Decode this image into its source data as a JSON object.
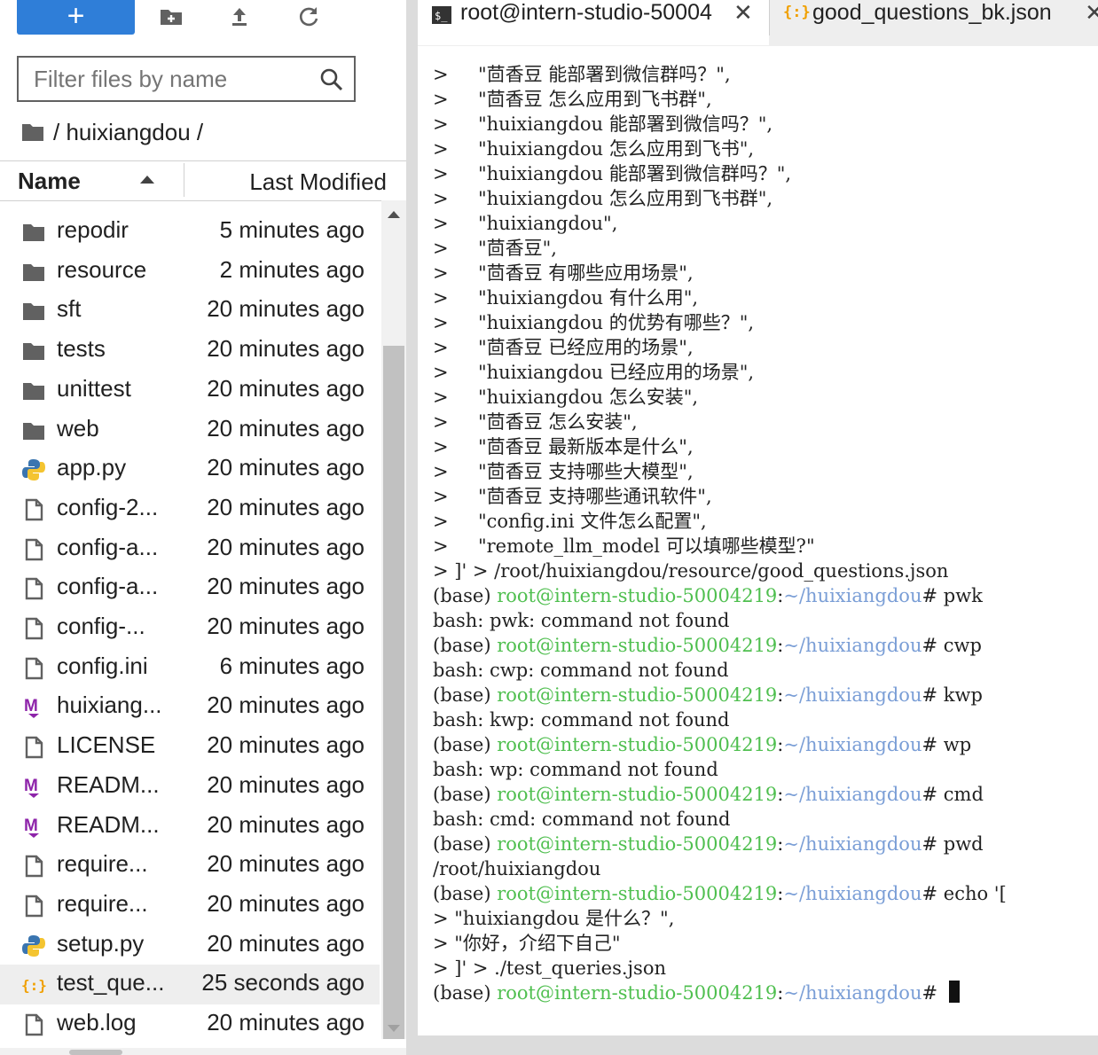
{
  "toolbar": {
    "new_label": "+",
    "icons": [
      "new-folder-icon",
      "upload-icon",
      "refresh-icon"
    ]
  },
  "filter": {
    "placeholder": "Filter files by name"
  },
  "breadcrumb": {
    "path": "/ huixiangdou /"
  },
  "columns": {
    "name": "Name",
    "modified": "Last Modified"
  },
  "files": [
    {
      "name": "repodir",
      "modified": "5 minutes ago",
      "icon": "folder-icon"
    },
    {
      "name": "resource",
      "modified": "2 minutes ago",
      "icon": "folder-icon"
    },
    {
      "name": "sft",
      "modified": "20 minutes ago",
      "icon": "folder-icon"
    },
    {
      "name": "tests",
      "modified": "20 minutes ago",
      "icon": "folder-icon"
    },
    {
      "name": "unittest",
      "modified": "20 minutes ago",
      "icon": "folder-icon"
    },
    {
      "name": "web",
      "modified": "20 minutes ago",
      "icon": "folder-icon"
    },
    {
      "name": "app.py",
      "modified": "20 minutes ago",
      "icon": "python-icon"
    },
    {
      "name": "config-2...",
      "modified": "20 minutes ago",
      "icon": "file-icon"
    },
    {
      "name": "config-a...",
      "modified": "20 minutes ago",
      "icon": "file-icon"
    },
    {
      "name": "config-a...",
      "modified": "20 minutes ago",
      "icon": "file-icon"
    },
    {
      "name": "config-...",
      "modified": "20 minutes ago",
      "icon": "file-icon"
    },
    {
      "name": "config.ini",
      "modified": "6 minutes ago",
      "icon": "file-icon"
    },
    {
      "name": "huixiang...",
      "modified": "20 minutes ago",
      "icon": "markdown-icon"
    },
    {
      "name": "LICENSE",
      "modified": "20 minutes ago",
      "icon": "file-icon"
    },
    {
      "name": "READM...",
      "modified": "20 minutes ago",
      "icon": "markdown-icon"
    },
    {
      "name": "READM...",
      "modified": "20 minutes ago",
      "icon": "markdown-icon"
    },
    {
      "name": "require...",
      "modified": "20 minutes ago",
      "icon": "file-icon"
    },
    {
      "name": "require...",
      "modified": "20 minutes ago",
      "icon": "file-icon"
    },
    {
      "name": "setup.py",
      "modified": "20 minutes ago",
      "icon": "python-icon"
    },
    {
      "name": "test_que...",
      "modified": "25 seconds ago",
      "icon": "json-icon",
      "selected": true
    },
    {
      "name": "web.log",
      "modified": "20 minutes ago",
      "icon": "file-icon"
    }
  ],
  "tabs": [
    {
      "label": "root@intern-studio-50004",
      "icon": "terminal-icon",
      "active": true
    },
    {
      "label": "good_questions_bk.json",
      "icon": "json-icon",
      "active": false
    }
  ],
  "prompt": {
    "env": "(base) ",
    "user": "root@intern-studio-50004219",
    "colon": ":",
    "path": "~/huixiangdou",
    "hash": "# "
  },
  "terminal": [
    {
      "t": "text",
      "text": ">     \"茴香豆 能部署到微信群吗？\","
    },
    {
      "t": "text",
      "text": ">     \"茴香豆 怎么应用到飞书群\","
    },
    {
      "t": "text",
      "text": ">     \"huixiangdou 能部署到微信吗？\","
    },
    {
      "t": "text",
      "text": ">     \"huixiangdou 怎么应用到飞书\","
    },
    {
      "t": "text",
      "text": ">     \"huixiangdou 能部署到微信群吗？\","
    },
    {
      "t": "text",
      "text": ">     \"huixiangdou 怎么应用到飞书群\","
    },
    {
      "t": "text",
      "text": ">     \"huixiangdou\","
    },
    {
      "t": "text",
      "text": ">     \"茴香豆\","
    },
    {
      "t": "text",
      "text": ">     \"茴香豆 有哪些应用场景\","
    },
    {
      "t": "text",
      "text": ">     \"huixiangdou 有什么用\","
    },
    {
      "t": "text",
      "text": ">     \"huixiangdou 的优势有哪些？\","
    },
    {
      "t": "text",
      "text": ">     \"茴香豆 已经应用的场景\","
    },
    {
      "t": "text",
      "text": ">     \"huixiangdou 已经应用的场景\","
    },
    {
      "t": "text",
      "text": ">     \"huixiangdou 怎么安装\","
    },
    {
      "t": "text",
      "text": ">     \"茴香豆 怎么安装\","
    },
    {
      "t": "text",
      "text": ">     \"茴香豆 最新版本是什么\","
    },
    {
      "t": "text",
      "text": ">     \"茴香豆 支持哪些大模型\","
    },
    {
      "t": "text",
      "text": ">     \"茴香豆 支持哪些通讯软件\","
    },
    {
      "t": "text",
      "text": ">     \"config.ini 文件怎么配置\","
    },
    {
      "t": "text",
      "text": ">     \"remote_llm_model 可以填哪些模型?\""
    },
    {
      "t": "text",
      "text": "> ]' > /root/huixiangdou/resource/good_questions.json"
    },
    {
      "t": "prompt",
      "cmd": "pwk"
    },
    {
      "t": "text",
      "text": "bash: pwk: command not found"
    },
    {
      "t": "prompt",
      "cmd": "cwp"
    },
    {
      "t": "text",
      "text": "bash: cwp: command not found"
    },
    {
      "t": "prompt",
      "cmd": "kwp"
    },
    {
      "t": "text",
      "text": "bash: kwp: command not found"
    },
    {
      "t": "prompt",
      "cmd": "wp"
    },
    {
      "t": "text",
      "text": "bash: wp: command not found"
    },
    {
      "t": "prompt",
      "cmd": "cmd"
    },
    {
      "t": "text",
      "text": "bash: cmd: command not found"
    },
    {
      "t": "prompt",
      "cmd": "pwd"
    },
    {
      "t": "text",
      "text": "/root/huixiangdou"
    },
    {
      "t": "prompt",
      "cmd": "echo '["
    },
    {
      "t": "text",
      "text": "> \"huixiangdou 是什么？\","
    },
    {
      "t": "text",
      "text": "> \"你好，介绍下自己\""
    },
    {
      "t": "text",
      "text": "> ]' > ./test_queries.json"
    },
    {
      "t": "prompt",
      "cmd": "",
      "cursor": true
    }
  ]
}
